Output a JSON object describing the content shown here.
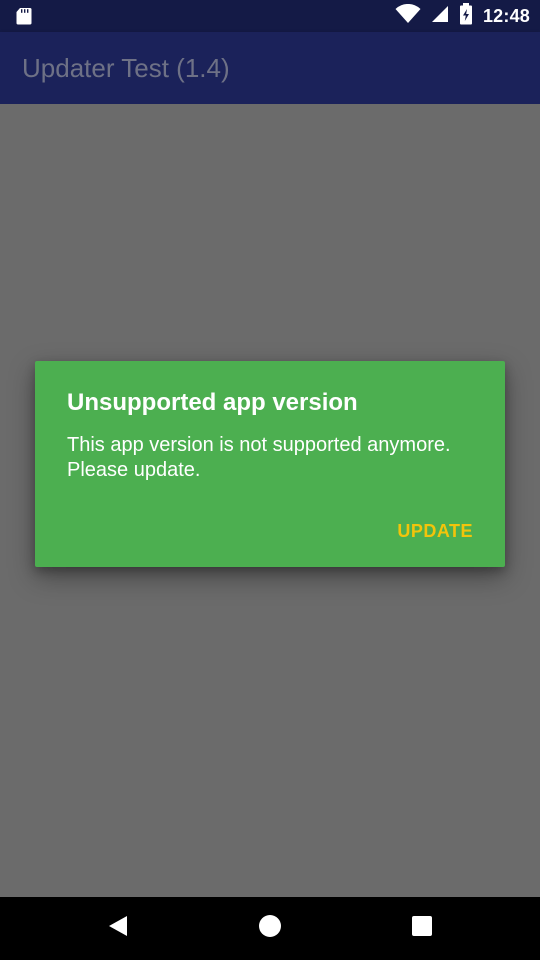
{
  "status_bar": {
    "time": "12:48",
    "icons": [
      "sd-card-icon",
      "wifi-icon",
      "signal-icon",
      "battery-charging-icon"
    ]
  },
  "toolbar": {
    "title": "Updater Test (1.4)"
  },
  "dialog": {
    "title": "Unsupported app version",
    "message": "This app version is not supported anymore. Please update.",
    "button_label": "UPDATE",
    "colors": {
      "background": "#4caf50",
      "button_text": "#f2c40b"
    }
  },
  "nav_bar": {
    "buttons": [
      "back-icon",
      "home-icon",
      "recents-icon"
    ]
  }
}
